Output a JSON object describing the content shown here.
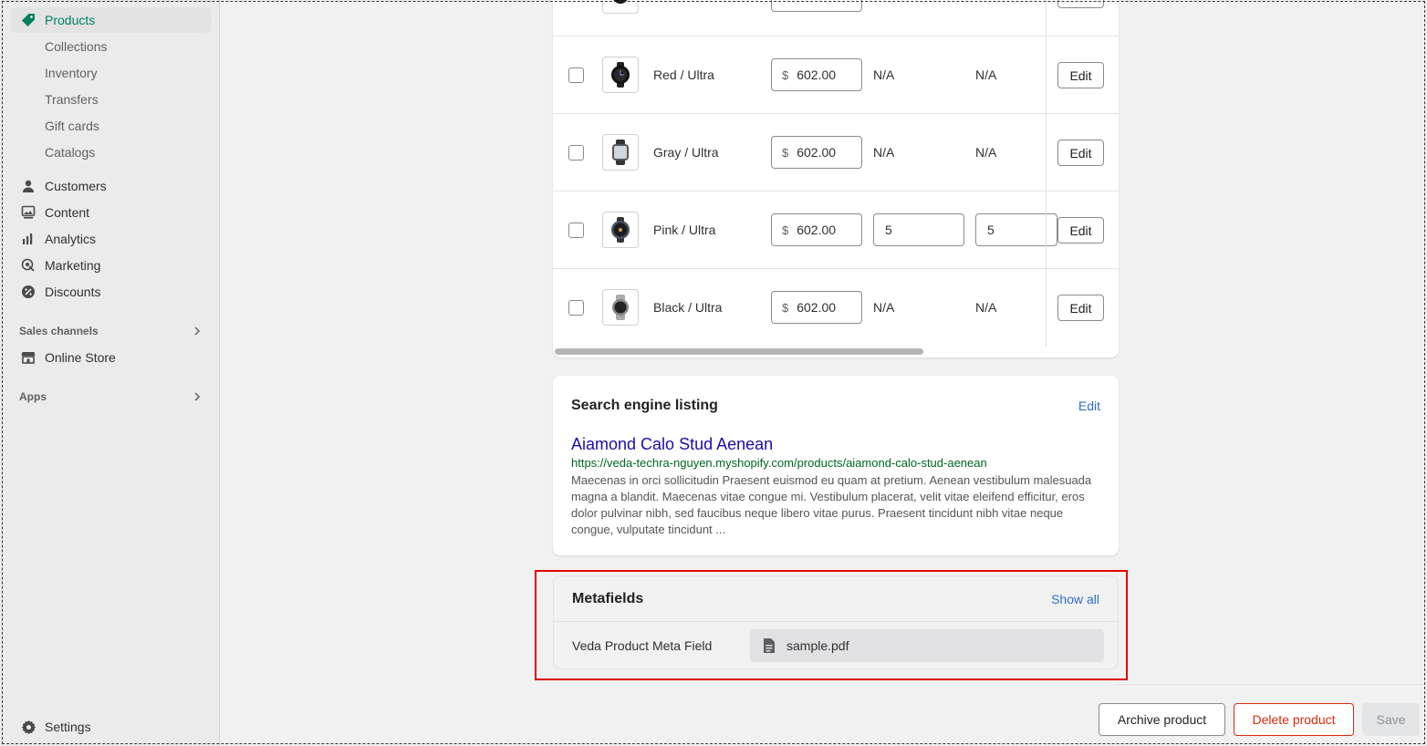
{
  "sidebar": {
    "products": "Products",
    "sub_items": [
      "Collections",
      "Inventory",
      "Transfers",
      "Gift cards",
      "Catalogs"
    ],
    "main_items": [
      "Customers",
      "Content",
      "Analytics",
      "Marketing",
      "Discounts"
    ],
    "sales_channels": "Sales channels",
    "online_store": "Online Store",
    "apps": "Apps",
    "settings": "Settings"
  },
  "variants": {
    "currency": "$",
    "edit_label": "Edit",
    "rows": [
      {
        "name": "Red / Ultra",
        "price": "602.00",
        "available": "N/A",
        "on_hand": "N/A"
      },
      {
        "name": "Gray / Ultra",
        "price": "602.00",
        "available": "N/A",
        "on_hand": "N/A"
      },
      {
        "name": "Pink / Ultra",
        "price": "602.00",
        "available": "5",
        "on_hand": "5"
      },
      {
        "name": "Black / Ultra",
        "price": "602.00",
        "available": "N/A",
        "on_hand": "N/A"
      }
    ]
  },
  "seo": {
    "title": "Search engine listing",
    "edit": "Edit",
    "page_title": "Aiamond Calo Stud Aenean",
    "url": "https://veda-techra-nguyen.myshopify.com/products/aiamond-calo-stud-aenean",
    "description": "Maecenas in orci sollicitudin Praesent euismod eu quam at pretium. Aenean vestibulum malesuada magna a blandit. Maecenas vitae congue mi. Vestibulum placerat, velit vitae eleifend efficitur, eros dolor pulvinar nibh, sed faucibus neque libero vitae purus. Praesent tincidunt nibh vitae neque congue, vulputate tincidunt ..."
  },
  "metafields": {
    "title": "Metafields",
    "show_all": "Show all",
    "field_label": "Veda Product Meta Field",
    "file_name": "sample.pdf"
  },
  "actions": {
    "archive": "Archive product",
    "delete": "Delete product",
    "save": "Save"
  },
  "colors": {
    "accent_green": "#007f5f",
    "link_blue": "#2c6ecb",
    "danger_red": "#d72c0d",
    "highlight_red": "#e00000"
  }
}
